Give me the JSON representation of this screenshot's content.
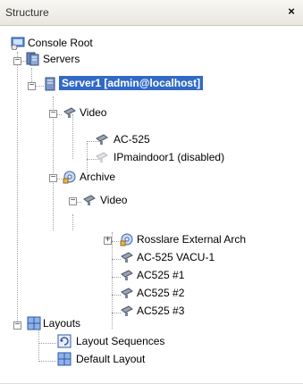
{
  "panel": {
    "title": "Structure",
    "close_glyph": "×"
  },
  "tree": {
    "console_root": "Console Root",
    "servers": "Servers",
    "server1": "Server1 [admin@localhost]",
    "video": "Video",
    "ac525": "AC-525",
    "ipmaindoor": "IPmaindoor1 (disabled)",
    "archive": "Archive",
    "archive_video": "Video",
    "rosslare": "Rosslare External Arch",
    "ac525_vacu": "AC-525 VACU-1",
    "ac525_1": "AC525 #1",
    "ac525_2": "AC525 #2",
    "ac525_3": "AC525 #3",
    "layouts": "Layouts",
    "layout_sequences": "Layout Sequences",
    "default_layout": "Default Layout"
  },
  "colors": {
    "selection": "#316ac5",
    "title_bar": "#eeece4"
  },
  "icons": {
    "console_root": "console-root-icon",
    "servers": "servers-icon",
    "server": "server-icon",
    "camera": "camera-icon",
    "archive": "archive-icon",
    "layouts": "layouts-icon",
    "layout_sequence": "layout-sequence-icon",
    "layout": "layout-icon"
  }
}
